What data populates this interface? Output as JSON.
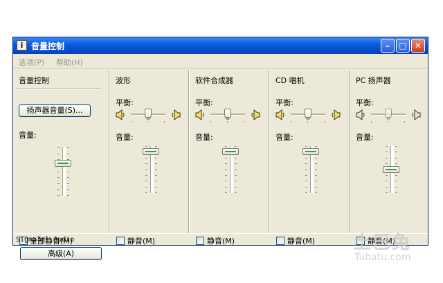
{
  "window": {
    "title": "音量控制"
  },
  "titlebar_buttons": {
    "minimize": "–",
    "maximize": "□",
    "close": "✕"
  },
  "menu": [
    "选项(P)",
    "帮助(H)"
  ],
  "master": {
    "title": "音量控制",
    "advanced_speaker_button": "扬声器音量(S)...",
    "volume_label": "音量:",
    "volume_level": 0.7,
    "mute_all_label": "全部静音(M)",
    "advanced_button": "高级(A)"
  },
  "channels": [
    {
      "title": "波形",
      "balance_label": "平衡:",
      "volume_label": "音量:",
      "mute_label": "静音(M)",
      "volume_level": 0.95,
      "balance": 0.5,
      "enabled": true
    },
    {
      "title": "软件合成器",
      "balance_label": "平衡:",
      "volume_label": "音量:",
      "mute_label": "静音(M)",
      "volume_level": 0.95,
      "balance": 0.5,
      "enabled": true
    },
    {
      "title": "CD 唱机",
      "balance_label": "平衡:",
      "volume_label": "音量:",
      "mute_label": "静音(M)",
      "volume_level": 0.95,
      "balance": 0.5,
      "enabled": true
    },
    {
      "title": "PC 扬声器",
      "balance_label": "平衡:",
      "volume_label": "音量:",
      "mute_label": "静音(M)",
      "volume_level": 0.5,
      "balance": 0.5,
      "enabled": false
    }
  ],
  "statusbar": {
    "text": "SigmaTel Audio"
  },
  "watermark": {
    "main": "土巴兔",
    "sub": "Tubatu.com"
  }
}
